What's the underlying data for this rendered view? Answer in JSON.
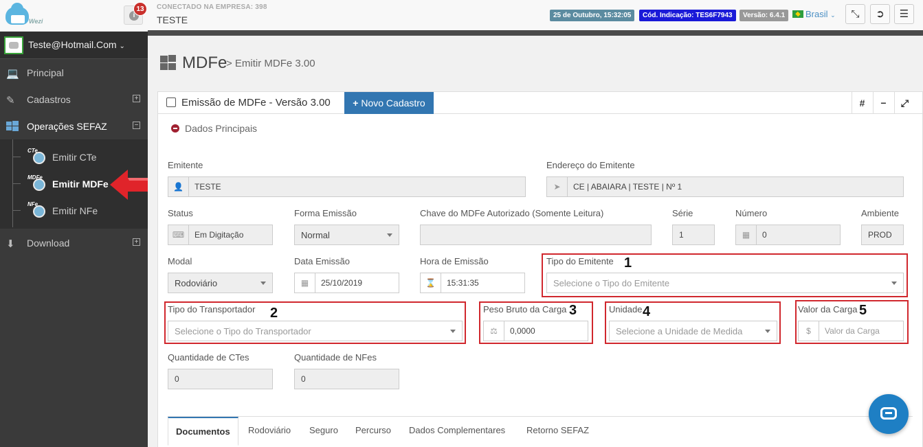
{
  "header": {
    "notification_count": "13",
    "company_label": "CONECTADO NA EMPRESA: 398",
    "company_name": "TESTE",
    "datetime": "25 de Outubro, 15:32:05",
    "indication_code": "Cód. Indicação: TES6F7943",
    "version": "Versão: 6.4.1",
    "language": "Brasil",
    "logo_text": "Wezi"
  },
  "sidebar": {
    "user_email": "Teste@Hotmail.Com",
    "items": [
      {
        "label": "Principal",
        "icon": "laptop-icon"
      },
      {
        "label": "Cadastros",
        "icon": "edit-icon",
        "toggle": "+"
      },
      {
        "label": "Operações SEFAZ",
        "icon": "windows-icon",
        "toggle": "−"
      },
      {
        "label": "Download",
        "icon": "download-icon",
        "toggle": "+"
      }
    ],
    "sub_items": [
      {
        "label": "Emitir CTe",
        "badge": "CTe"
      },
      {
        "label": "Emitir MDFe",
        "badge": "MDFe"
      },
      {
        "label": "Emitir NFe",
        "badge": "NFe"
      }
    ]
  },
  "page": {
    "title": "MDFe",
    "subtitle": "> Emitir MDFe  3.00"
  },
  "panel": {
    "title": "Emissão de MDFe - Versão 3.00",
    "new_button": "Novo Cadastro",
    "hash_btn": "#",
    "min_btn": "−",
    "section": "Dados Principais"
  },
  "form": {
    "emitente": {
      "label": "Emitente",
      "value": "TESTE"
    },
    "endereco": {
      "label": "Endereço do Emitente",
      "value": "CE | ABAIARA | TESTE | Nº 1"
    },
    "status": {
      "label": "Status",
      "value": "Em Digitação"
    },
    "forma_emissao": {
      "label": "Forma Emissão",
      "value": "Normal"
    },
    "chave": {
      "label": "Chave do MDFe Autorizado (Somente Leitura)",
      "value": ""
    },
    "serie": {
      "label": "Série",
      "value": "1"
    },
    "numero": {
      "label": "Número",
      "value": "0"
    },
    "ambiente": {
      "label": "Ambiente",
      "value": "PROD"
    },
    "modal": {
      "label": "Modal",
      "value": "Rodoviário"
    },
    "data_emissao": {
      "label": "Data Emissão",
      "value": "25/10/2019"
    },
    "hora_emissao": {
      "label": "Hora de Emissão",
      "value": "15:31:35"
    },
    "tipo_emitente": {
      "label": "Tipo do Emitente",
      "placeholder": "Selecione o Tipo do Emitente",
      "marker": "1"
    },
    "tipo_transportador": {
      "label": "Tipo do Transportador",
      "placeholder": "Selecione o Tipo do Transportador",
      "marker": "2"
    },
    "peso_bruto": {
      "label": "Peso Bruto da Carga",
      "value": "0,0000",
      "marker": "3"
    },
    "unidade": {
      "label": "Unidade",
      "placeholder": "Selecione a Unidade de Medida",
      "marker": "4"
    },
    "valor_carga": {
      "label": "Valor da Carga",
      "placeholder": "Valor da Carga",
      "prefix": "$",
      "marker": "5"
    },
    "qtd_ctes": {
      "label": "Quantidade de CTes",
      "value": "0"
    },
    "qtd_nfes": {
      "label": "Quantidade de NFes",
      "value": "0"
    }
  },
  "tabs": [
    "Documentos",
    "Rodoviário",
    "Seguro",
    "Percurso",
    "Dados Complementares",
    "Retorno SEFAZ"
  ],
  "colors": {
    "accent": "#3276b1",
    "highlight": "#d0272d",
    "sidebar": "#3a3a3a"
  }
}
